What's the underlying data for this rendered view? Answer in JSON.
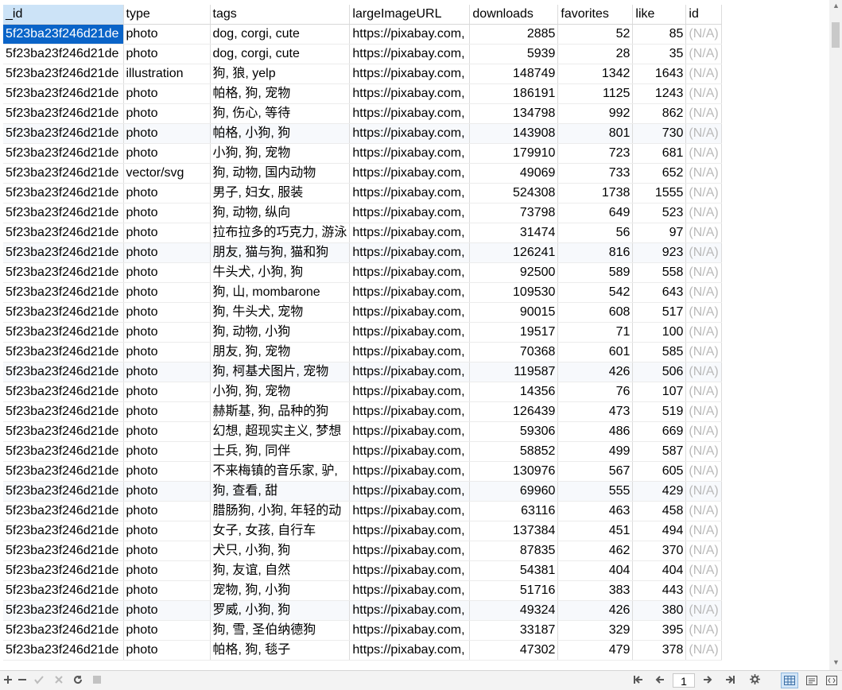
{
  "grid": {
    "columns": [
      "_id",
      "type",
      "tags",
      "largeImageURL",
      "downloads",
      "favorites",
      "like",
      "id"
    ],
    "rows": [
      [
        "5f23ba23f246d21de",
        "photo",
        "dog, corgi, cute",
        "https://pixabay.com,",
        "2885",
        "52",
        "85",
        "(N/A)"
      ],
      [
        "5f23ba23f246d21de",
        "photo",
        "dog, corgi, cute",
        "https://pixabay.com,",
        "5939",
        "28",
        "35",
        "(N/A)"
      ],
      [
        "5f23ba23f246d21de",
        "illustration",
        "狗, 狼, yelp",
        "https://pixabay.com,",
        "148749",
        "1342",
        "1643",
        "(N/A)"
      ],
      [
        "5f23ba23f246d21de",
        "photo",
        "帕格, 狗, 宠物",
        "https://pixabay.com,",
        "186191",
        "1125",
        "1243",
        "(N/A)"
      ],
      [
        "5f23ba23f246d21de",
        "photo",
        "狗, 伤心, 等待",
        "https://pixabay.com,",
        "134798",
        "992",
        "862",
        "(N/A)"
      ],
      [
        "5f23ba23f246d21de",
        "photo",
        "帕格, 小狗, 狗",
        "https://pixabay.com,",
        "143908",
        "801",
        "730",
        "(N/A)"
      ],
      [
        "5f23ba23f246d21de",
        "photo",
        "小狗, 狗, 宠物",
        "https://pixabay.com,",
        "179910",
        "723",
        "681",
        "(N/A)"
      ],
      [
        "5f23ba23f246d21de",
        "vector/svg",
        "狗, 动物, 国内动物",
        "https://pixabay.com,",
        "49069",
        "733",
        "652",
        "(N/A)"
      ],
      [
        "5f23ba23f246d21de",
        "photo",
        "男子, 妇女, 服装",
        "https://pixabay.com,",
        "524308",
        "1738",
        "1555",
        "(N/A)"
      ],
      [
        "5f23ba23f246d21de",
        "photo",
        "狗, 动物, 纵向",
        "https://pixabay.com,",
        "73798",
        "649",
        "523",
        "(N/A)"
      ],
      [
        "5f23ba23f246d21de",
        "photo",
        "拉布拉多的巧克力, 游泳",
        "https://pixabay.com,",
        "31474",
        "56",
        "97",
        "(N/A)"
      ],
      [
        "5f23ba23f246d21de",
        "photo",
        "朋友, 猫与狗, 猫和狗",
        "https://pixabay.com,",
        "126241",
        "816",
        "923",
        "(N/A)"
      ],
      [
        "5f23ba23f246d21de",
        "photo",
        "牛头犬, 小狗, 狗",
        "https://pixabay.com,",
        "92500",
        "589",
        "558",
        "(N/A)"
      ],
      [
        "5f23ba23f246d21de",
        "photo",
        "狗, 山, mombarone",
        "https://pixabay.com,",
        "109530",
        "542",
        "643",
        "(N/A)"
      ],
      [
        "5f23ba23f246d21de",
        "photo",
        "狗, 牛头犬, 宠物",
        "https://pixabay.com,",
        "90015",
        "608",
        "517",
        "(N/A)"
      ],
      [
        "5f23ba23f246d21de",
        "photo",
        "狗, 动物, 小狗",
        "https://pixabay.com,",
        "19517",
        "71",
        "100",
        "(N/A)"
      ],
      [
        "5f23ba23f246d21de",
        "photo",
        "朋友, 狗, 宠物",
        "https://pixabay.com,",
        "70368",
        "601",
        "585",
        "(N/A)"
      ],
      [
        "5f23ba23f246d21de",
        "photo",
        "狗, 柯基犬图片, 宠物",
        "https://pixabay.com,",
        "119587",
        "426",
        "506",
        "(N/A)"
      ],
      [
        "5f23ba23f246d21de",
        "photo",
        "小狗, 狗, 宠物",
        "https://pixabay.com,",
        "14356",
        "76",
        "107",
        "(N/A)"
      ],
      [
        "5f23ba23f246d21de",
        "photo",
        "赫斯基, 狗, 品种的狗",
        "https://pixabay.com,",
        "126439",
        "473",
        "519",
        "(N/A)"
      ],
      [
        "5f23ba23f246d21de",
        "photo",
        "幻想, 超现实主义, 梦想",
        "https://pixabay.com,",
        "59306",
        "486",
        "669",
        "(N/A)"
      ],
      [
        "5f23ba23f246d21de",
        "photo",
        "士兵, 狗, 同伴",
        "https://pixabay.com,",
        "58852",
        "499",
        "587",
        "(N/A)"
      ],
      [
        "5f23ba23f246d21de",
        "photo",
        "不来梅镇的音乐家, 驴,",
        "https://pixabay.com,",
        "130976",
        "567",
        "605",
        "(N/A)"
      ],
      [
        "5f23ba23f246d21de",
        "photo",
        "狗, 查看, 甜",
        "https://pixabay.com,",
        "69960",
        "555",
        "429",
        "(N/A)"
      ],
      [
        "5f23ba23f246d21de",
        "photo",
        "腊肠狗, 小狗, 年轻的动",
        "https://pixabay.com,",
        "63116",
        "463",
        "458",
        "(N/A)"
      ],
      [
        "5f23ba23f246d21de",
        "photo",
        "女子, 女孩, 自行车",
        "https://pixabay.com,",
        "137384",
        "451",
        "494",
        "(N/A)"
      ],
      [
        "5f23ba23f246d21de",
        "photo",
        "犬只, 小狗, 狗",
        "https://pixabay.com,",
        "87835",
        "462",
        "370",
        "(N/A)"
      ],
      [
        "5f23ba23f246d21de",
        "photo",
        "狗, 友谊, 自然",
        "https://pixabay.com,",
        "54381",
        "404",
        "404",
        "(N/A)"
      ],
      [
        "5f23ba23f246d21de",
        "photo",
        "宠物, 狗, 小狗",
        "https://pixabay.com,",
        "51716",
        "383",
        "443",
        "(N/A)"
      ],
      [
        "5f23ba23f246d21de",
        "photo",
        "罗威, 小狗, 狗",
        "https://pixabay.com,",
        "49324",
        "426",
        "380",
        "(N/A)"
      ],
      [
        "5f23ba23f246d21de",
        "photo",
        "狗, 雪, 圣伯纳德狗",
        "https://pixabay.com,",
        "33187",
        "329",
        "395",
        "(N/A)"
      ],
      [
        "5f23ba23f246d21de",
        "photo",
        "帕格, 狗, 毯子",
        "https://pixabay.com,",
        "47302",
        "479",
        "378",
        "(N/A)"
      ]
    ],
    "numeric_columns": [
      4,
      5,
      6
    ],
    "na_columns": [
      7
    ],
    "alt_rows": [
      5,
      11,
      17,
      23,
      29
    ],
    "selected": {
      "row": 0,
      "col": 0
    }
  },
  "toolbar": {
    "left_icons": [
      "add-icon",
      "remove-icon",
      "apply-icon",
      "discard-icon",
      "refresh-icon",
      "stop-icon"
    ],
    "nav_icons": [
      "first-page-icon",
      "previous-page-icon",
      "next-page-icon",
      "last-page-icon",
      "settings-icon"
    ],
    "page_number": "1",
    "view_icons": [
      "grid-view-icon",
      "form-view-icon",
      "text-view-icon"
    ],
    "active_view": "grid-view-icon"
  },
  "colors": {
    "selection": "#0a64c8",
    "header_selected": "#cce3f7",
    "na_text": "#b9b9b9",
    "alt_row": "#f7f9fc"
  }
}
